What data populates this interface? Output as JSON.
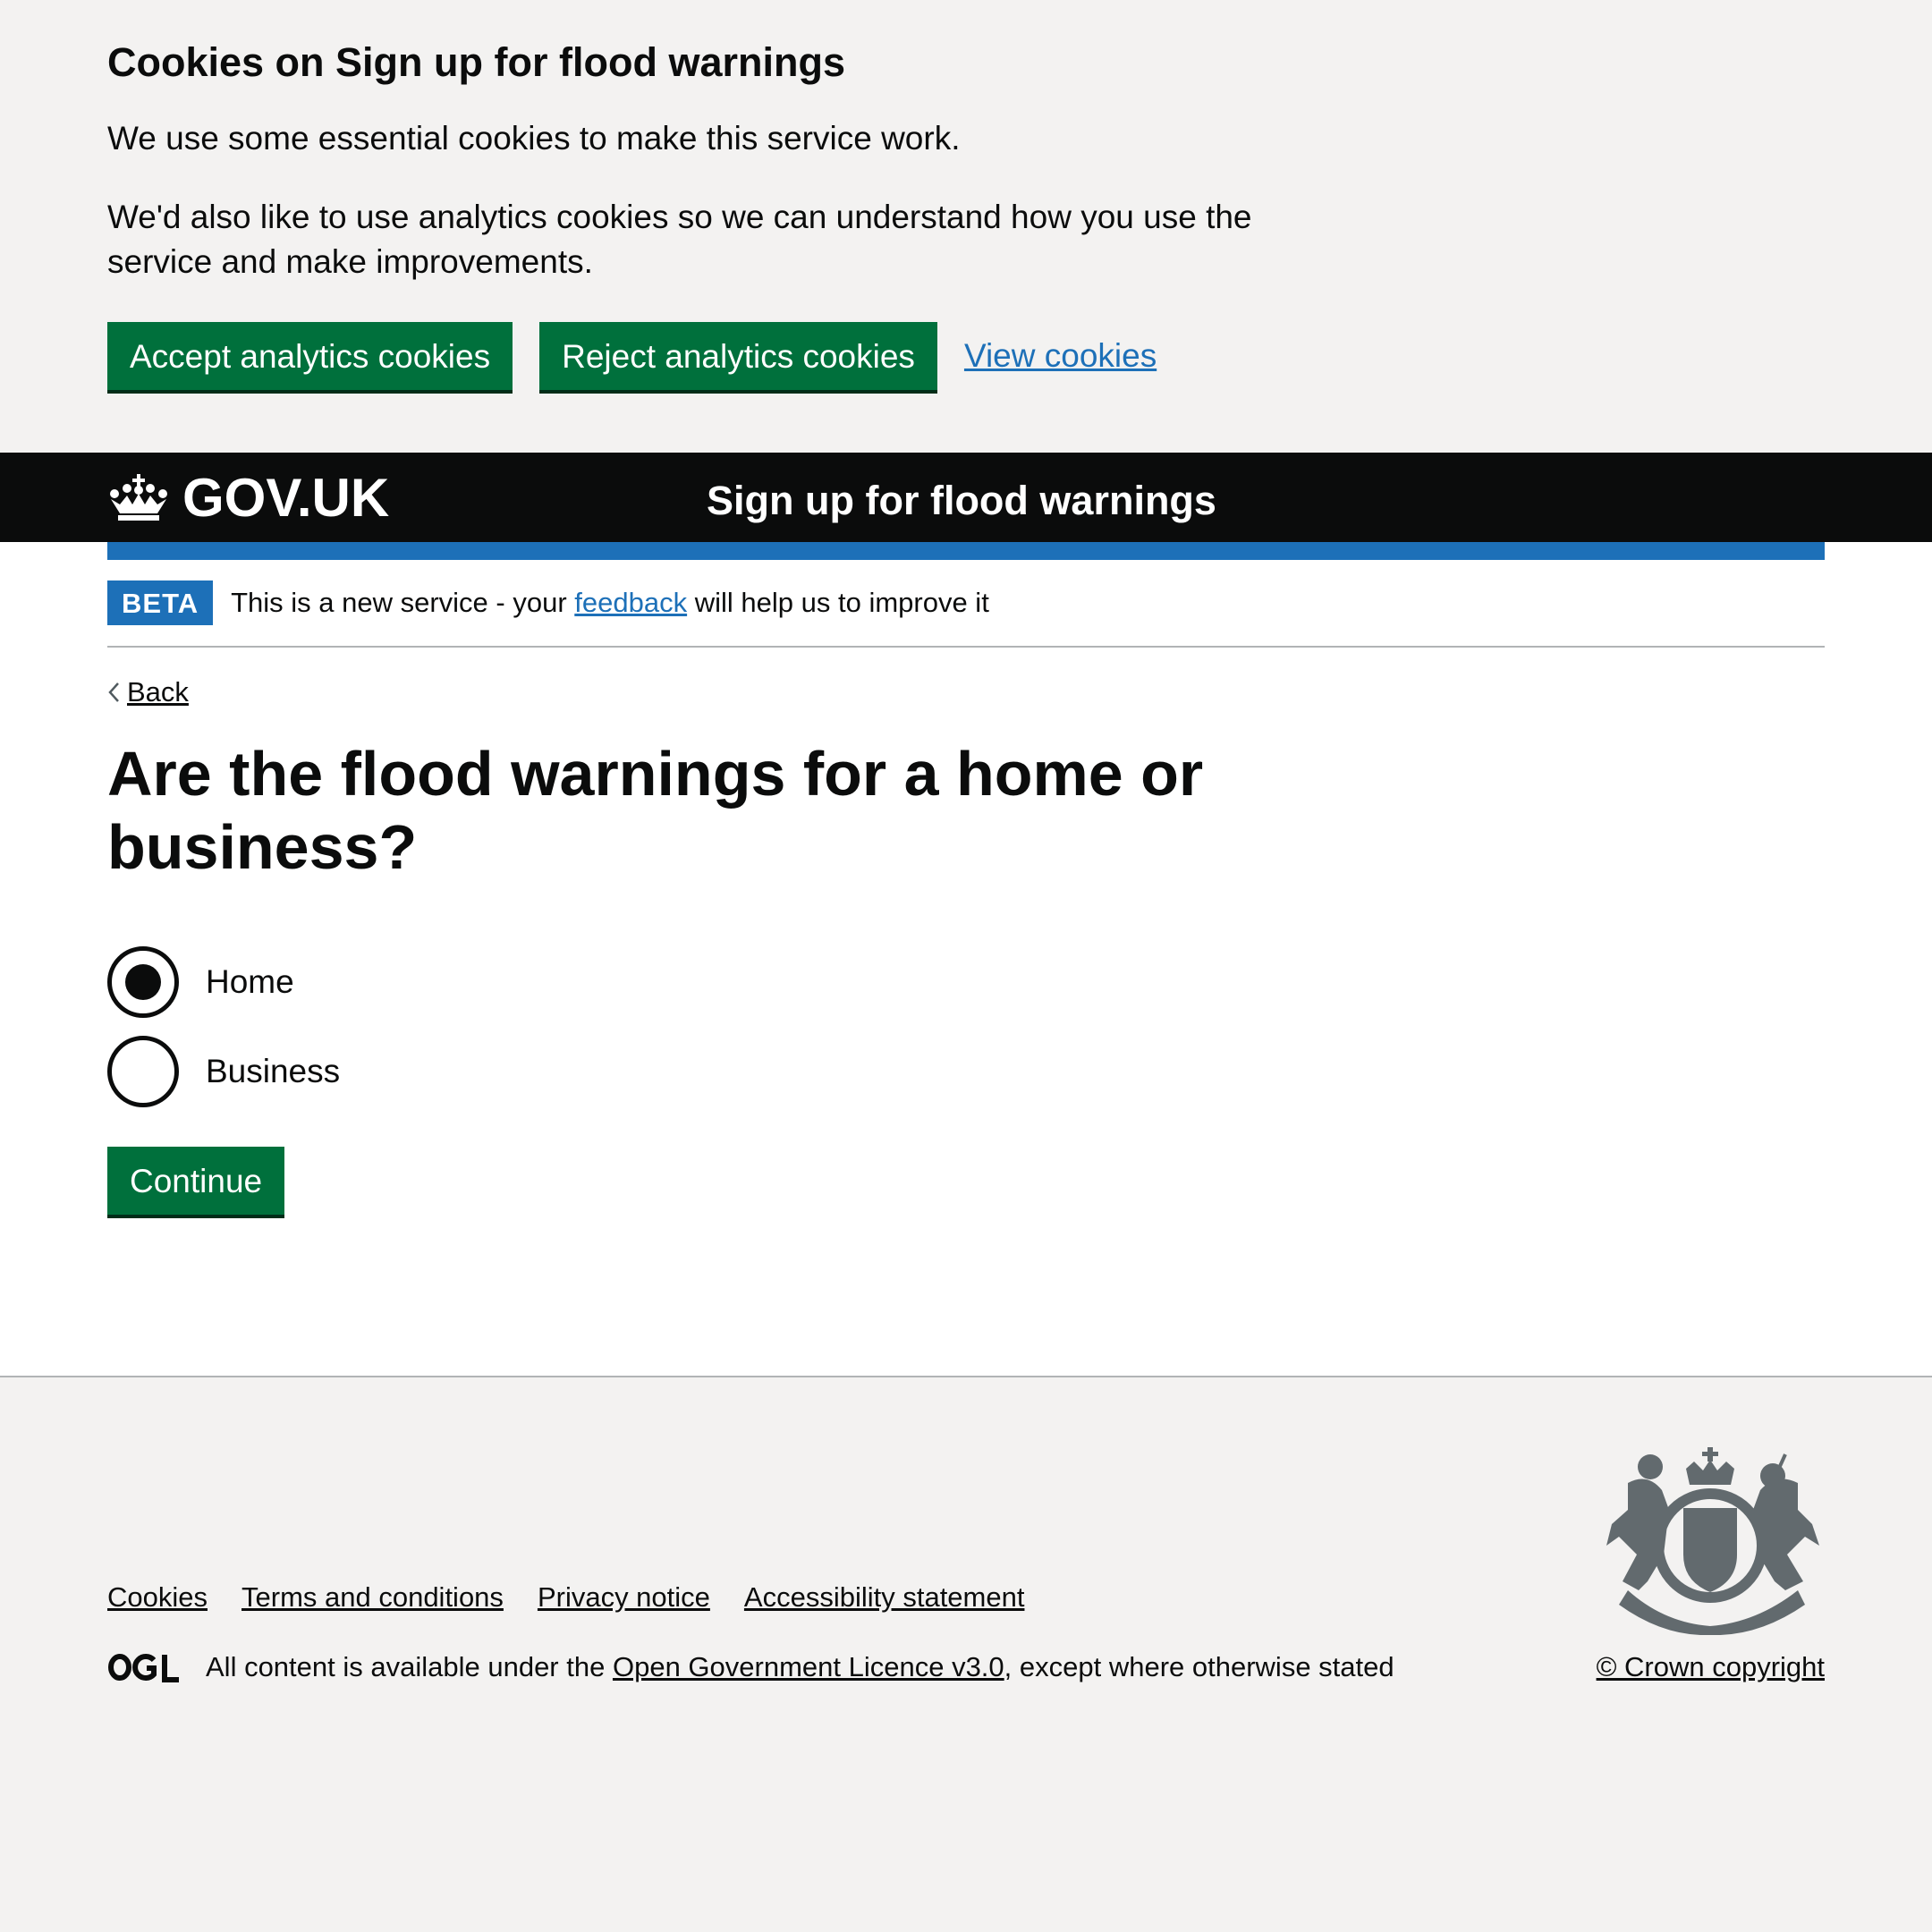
{
  "cookie_banner": {
    "heading": "Cookies on Sign up for flood warnings",
    "para1": "We use some essential cookies to make this service work.",
    "para2": "We'd also like to use analytics cookies so we can understand how you use the service and make improvements.",
    "accept_label": "Accept analytics cookies",
    "reject_label": "Reject analytics cookies",
    "view_label": "View cookies"
  },
  "header": {
    "logo_text": "GOV.UK",
    "service_name": "Sign up for flood warnings"
  },
  "phase_banner": {
    "tag": "BETA",
    "text_before": "This is a new service - your",
    "link": "feedback",
    "text_after": "will help us to improve it"
  },
  "back_link": "Back",
  "question": "Are the flood warnings for a home or business?",
  "options": [
    {
      "label": "Home",
      "selected": true
    },
    {
      "label": "Business",
      "selected": false
    }
  ],
  "continue_label": "Continue",
  "footer": {
    "links": [
      "Cookies",
      "Terms and conditions",
      "Privacy notice",
      "Accessibility statement"
    ],
    "licence_before": "All content is available under the",
    "licence_link": "Open Government Licence v3.0",
    "licence_after": ", except where otherwise stated",
    "copyright": "© Crown copyright"
  },
  "colors": {
    "green": "#00703c",
    "blue": "#1d70b8",
    "black": "#0b0c0c",
    "grey_bg": "#f3f2f1"
  }
}
